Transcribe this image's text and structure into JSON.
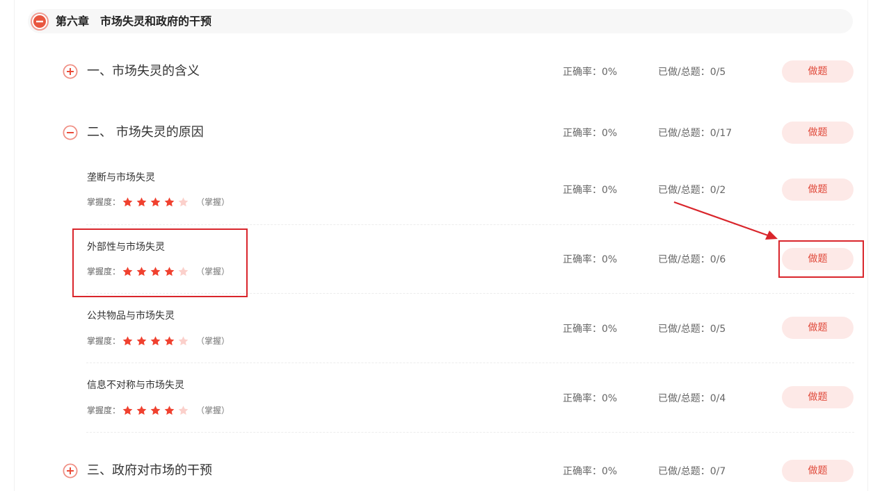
{
  "chapter": {
    "title": "第六章　市场失灵和政府的干预"
  },
  "sections": [
    {
      "title": "一、市场失灵的含义",
      "accuracy": "正确率：0%",
      "progress": "已做/总题：0/5",
      "button": "做题"
    },
    {
      "title": "二、 市场失灵的原因",
      "accuracy": "正确率：0%",
      "progress": "已做/总题：0/17",
      "button": "做题"
    },
    {
      "title": "三、政府对市场的干预",
      "accuracy": "正确率：0%",
      "progress": "已做/总题：0/7",
      "button": "做题"
    }
  ],
  "points": [
    {
      "name": "垄断与市场失灵",
      "mastery_label": "掌握度：",
      "stars": 4,
      "stars_max": 5,
      "level": "（掌握）",
      "accuracy": "正确率：0%",
      "progress": "已做/总题：0/2",
      "button": "做题"
    },
    {
      "name": "外部性与市场失灵",
      "mastery_label": "掌握度：",
      "stars": 4,
      "stars_max": 5,
      "level": "（掌握）",
      "accuracy": "正确率：0%",
      "progress": "已做/总题：0/6",
      "button": "做题"
    },
    {
      "name": "公共物品与市场失灵",
      "mastery_label": "掌握度：",
      "stars": 4,
      "stars_max": 5,
      "level": "（掌握）",
      "accuracy": "正确率：0%",
      "progress": "已做/总题：0/5",
      "button": "做题"
    },
    {
      "name": "信息不对称与市场失灵",
      "mastery_label": "掌握度：",
      "stars": 4,
      "stars_max": 5,
      "level": "（掌握）",
      "accuracy": "正确率：0%",
      "progress": "已做/总题：0/4",
      "button": "做题"
    }
  ],
  "icons": {
    "collapse": "minus-circle-icon",
    "expand": "plus-circle-icon",
    "star": "star-icon",
    "arrow": "annotation-arrow"
  },
  "colors": {
    "accent": "#e04a3b",
    "button_bg": "#fde9e7",
    "star_filled": "#f0412f",
    "star_empty": "#fbd0cb",
    "annotation": "#d9252b"
  }
}
